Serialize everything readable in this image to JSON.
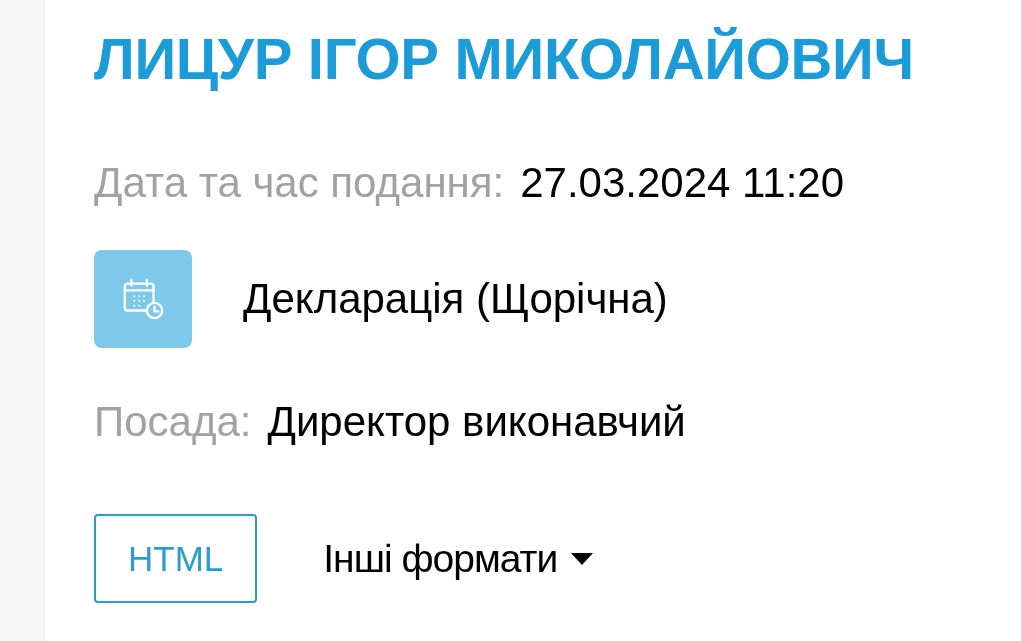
{
  "person": {
    "name": "ЛИЦУР ІГОР МИКОЛАЙОВИЧ"
  },
  "submitted": {
    "label": "Дата та час подання:",
    "value": "27.03.2024 11:20"
  },
  "document": {
    "type": "Декларація (Щорічна)"
  },
  "position": {
    "label": "Посада:",
    "value": "Директор виконавчий"
  },
  "actions": [
    {
      "kind": "button",
      "label": "HTML"
    },
    {
      "kind": "dropdown",
      "label": "Інші формати"
    }
  ]
}
